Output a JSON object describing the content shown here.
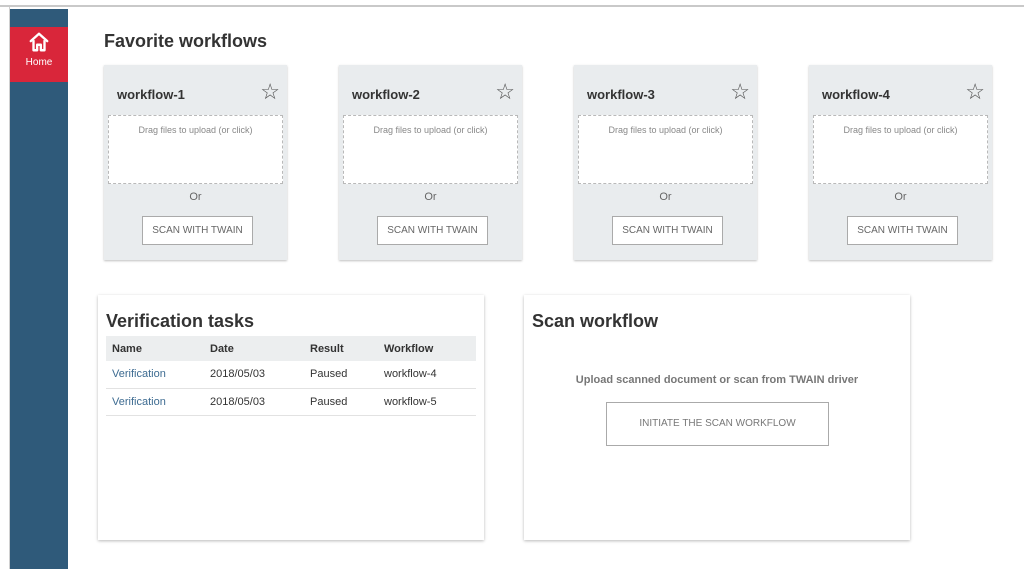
{
  "sidebar": {
    "home_label": "Home",
    "accent_color": "#d9263a",
    "bg_color": "#2f5a7a",
    "home_icon": "home-icon"
  },
  "favorites": {
    "title": "Favorite workflows",
    "cards": [
      {
        "name": "workflow-1",
        "drop_text": "Drag files to upload (or click)",
        "or_text": "Or",
        "scan_label": "SCAN WITH TWAIN",
        "star_icon": "star-outline-icon"
      },
      {
        "name": "workflow-2",
        "drop_text": "Drag files to upload (or click)",
        "or_text": "Or",
        "scan_label": "SCAN WITH TWAIN",
        "star_icon": "star-outline-icon"
      },
      {
        "name": "workflow-3",
        "drop_text": "Drag files to upload (or click)",
        "or_text": "Or",
        "scan_label": "SCAN WITH TWAIN",
        "star_icon": "star-outline-icon"
      },
      {
        "name": "workflow-4",
        "drop_text": "Drag files to upload (or click)",
        "or_text": "Or",
        "scan_label": "SCAN WITH TWAIN",
        "star_icon": "star-outline-icon"
      }
    ]
  },
  "verification": {
    "title": "Verification tasks",
    "columns": [
      "Name",
      "Date",
      "Result",
      "Workflow"
    ],
    "rows": [
      {
        "name": "Verification",
        "date": "2018/05/03",
        "result": "Paused",
        "workflow": "workflow-4"
      },
      {
        "name": "Verification",
        "date": "2018/05/03",
        "result": "Paused",
        "workflow": "workflow-5"
      }
    ]
  },
  "scan": {
    "title": "Scan workflow",
    "description": "Upload scanned document or scan from TWAIN driver",
    "button_label": "INITIATE THE SCAN WORKFLOW"
  }
}
